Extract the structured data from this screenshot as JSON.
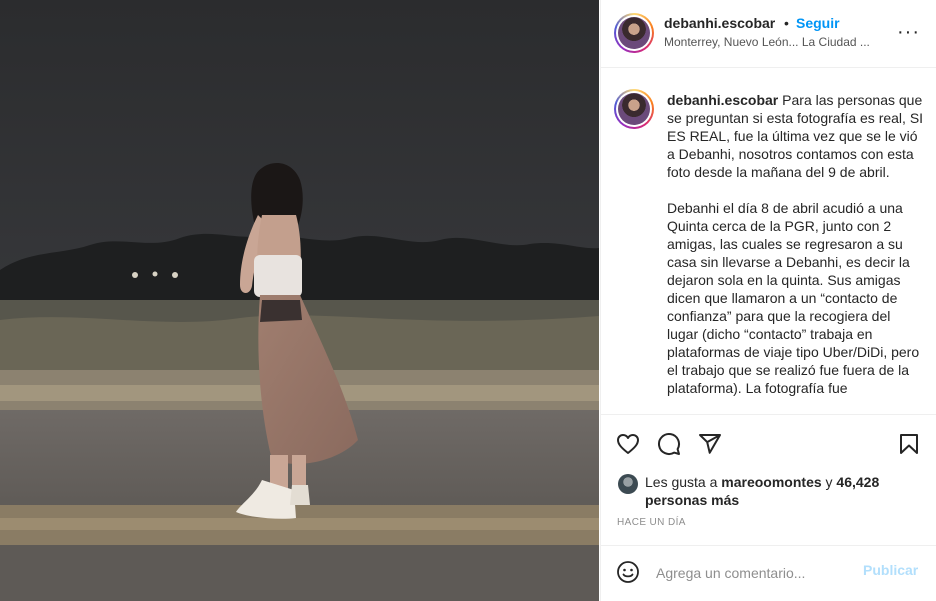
{
  "post": {
    "username": "debanhi.escobar",
    "separator": "•",
    "follow_label": "Seguir",
    "location": "Monterrey, Nuevo León... La Ciudad ...",
    "more_icon": "more-horizontal-icon",
    "more_glyph": "···"
  },
  "caption": {
    "username": "debanhi.escobar",
    "paragraph1": "Para las personas que se preguntan si esta fotografía es real, SI ES REAL, fue la última vez que se le vió a Debanhi, nosotros contamos con esta foto desde la mañana del 9 de abril.",
    "paragraph2": "Debanhi el día 8 de abril acudió a una Quinta cerca de la PGR, junto con 2 amigas, las cuales se regresaron a su casa sin llevarse a Debanhi, es decir la dejaron sola en la quinta. Sus amigas dicen que llamaron a un “contacto de confianza” para que la recogiera del lugar (dicho “contacto” trabaja en plataformas de viaje tipo Uber/DiDi, pero el trabajo que se realizó fue fuera de la plataforma). La fotografía fue"
  },
  "actions": {
    "icons": [
      "heart-icon",
      "comment-icon",
      "share-icon",
      "bookmark-icon"
    ]
  },
  "likes": {
    "prefix": "Les gusta a",
    "liker": "mareoomontes",
    "connector": "y",
    "others": "46,428 personas más"
  },
  "timestamp": "HACE UN DÍA",
  "comment": {
    "placeholder": "Agrega un comentario...",
    "emoji_icon": "emoji-icon",
    "post_label": "Publicar",
    "post_color": "#b2dffc"
  },
  "colors": {
    "accent": "#0095f6",
    "text": "#262626",
    "muted": "#8e8e8e",
    "border": "#efefef"
  }
}
